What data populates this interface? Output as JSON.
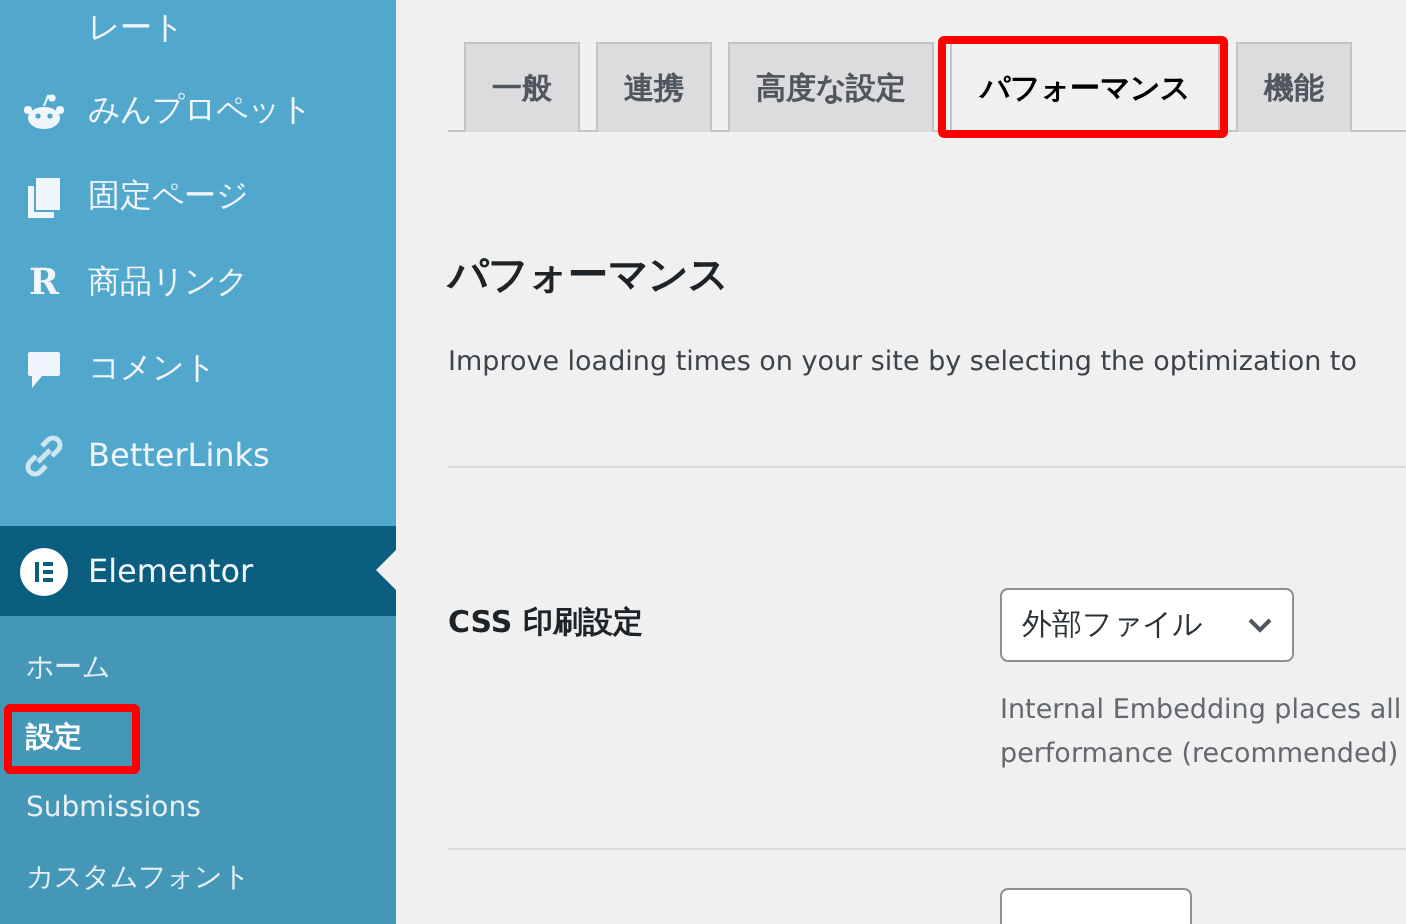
{
  "sidebar": {
    "items": [
      {
        "label": "レート",
        "kind": "plain",
        "current": false
      },
      {
        "label": "みんプロペット",
        "kind": "robot",
        "current": false
      },
      {
        "label": "固定ページ",
        "kind": "pages",
        "current": false
      },
      {
        "label": "商品リンク",
        "kind": "letter",
        "glyph": "R",
        "current": false
      },
      {
        "label": "コメント",
        "kind": "comment",
        "current": false
      },
      {
        "label": "BetterLinks",
        "kind": "link",
        "current": false
      },
      {
        "label": "Elementor",
        "kind": "elementor",
        "current": true
      }
    ],
    "submenu": [
      {
        "label": "ホーム",
        "selected": false,
        "highlighted": false
      },
      {
        "label": "設定",
        "selected": true,
        "highlighted": true
      },
      {
        "label": "Submissions",
        "selected": false,
        "highlighted": false
      },
      {
        "label": "カスタムフォント",
        "selected": false,
        "highlighted": false
      }
    ]
  },
  "tabs": [
    {
      "label": "一般",
      "selected": false,
      "highlighted": false
    },
    {
      "label": "連携",
      "selected": false,
      "highlighted": false
    },
    {
      "label": "高度な設定",
      "selected": false,
      "highlighted": false
    },
    {
      "label": "パフォーマンス",
      "selected": true,
      "highlighted": true
    },
    {
      "label": "機能",
      "selected": false,
      "highlighted": false
    }
  ],
  "section": {
    "title": "パフォーマンス",
    "description": "Improve loading times on your site by selecting the optimization to"
  },
  "settings": [
    {
      "label": "CSS 印刷設定",
      "value": "外部ファイル",
      "help_lines": [
        "Internal Embedding places all",
        "performance (recommended)"
      ]
    }
  ]
}
